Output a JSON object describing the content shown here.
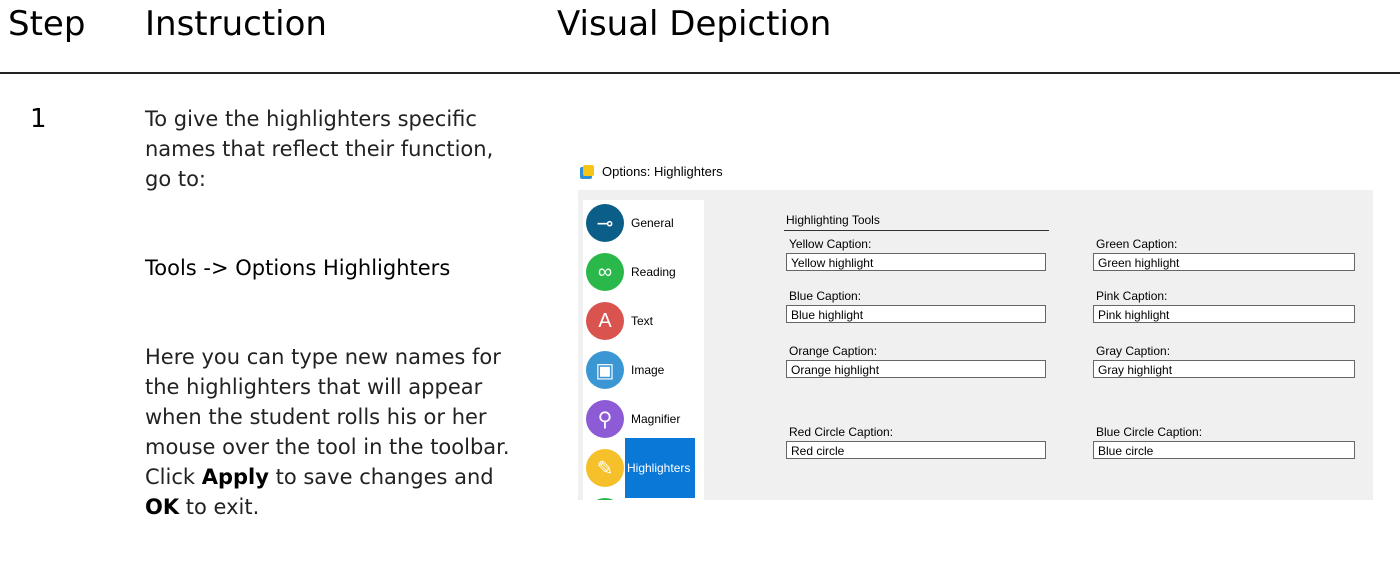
{
  "headers": {
    "step": "Step",
    "instruction": "Instruction",
    "visual": "Visual Depiction"
  },
  "step": {
    "number": "1",
    "intro": "To give the highlighters specific names that reflect their function, go to:",
    "path": "Tools -> Options Highlighters",
    "body_pre": "Here you can type new names for the highlighters that will appear when the student rolls his or her mouse over the tool in the toolbar.  Click ",
    "apply": "Apply",
    "body_mid": " to save changes and ",
    "ok": "OK",
    "body_post": " to exit."
  },
  "dialog": {
    "title": "Options: Highlighters",
    "nav": [
      {
        "label": "General",
        "icon": "key-icon",
        "color": "#0b5e87",
        "glyph": "⊸"
      },
      {
        "label": "Reading",
        "icon": "glasses-icon",
        "color": "#2ab84a",
        "glyph": "∞"
      },
      {
        "label": "Text",
        "icon": "letter-a-icon",
        "color": "#d9534f",
        "glyph": "A"
      },
      {
        "label": "Image",
        "icon": "picture-icon",
        "color": "#3b97d3",
        "glyph": "▣"
      },
      {
        "label": "Magnifier",
        "icon": "magnifier-icon",
        "color": "#8e5bd6",
        "glyph": "⚲"
      },
      {
        "label": "Highlighters",
        "icon": "pen-icon",
        "color": "#f5c02a",
        "glyph": "✎"
      }
    ],
    "section": "Highlighting Tools",
    "fields": [
      {
        "label": "Yellow Caption:",
        "value": "Yellow highlight"
      },
      {
        "label": "Green Caption:",
        "value": "Green highlight"
      },
      {
        "label": "Blue Caption:",
        "value": "Blue highlight"
      },
      {
        "label": "Pink Caption:",
        "value": "Pink highlight"
      },
      {
        "label": "Orange Caption:",
        "value": "Orange highlight"
      },
      {
        "label": "Gray Caption:",
        "value": "Gray highlight"
      },
      {
        "label": "Red Circle Caption:",
        "value": "Red circle"
      },
      {
        "label": "Blue Circle Caption:",
        "value": "Blue circle"
      }
    ]
  }
}
